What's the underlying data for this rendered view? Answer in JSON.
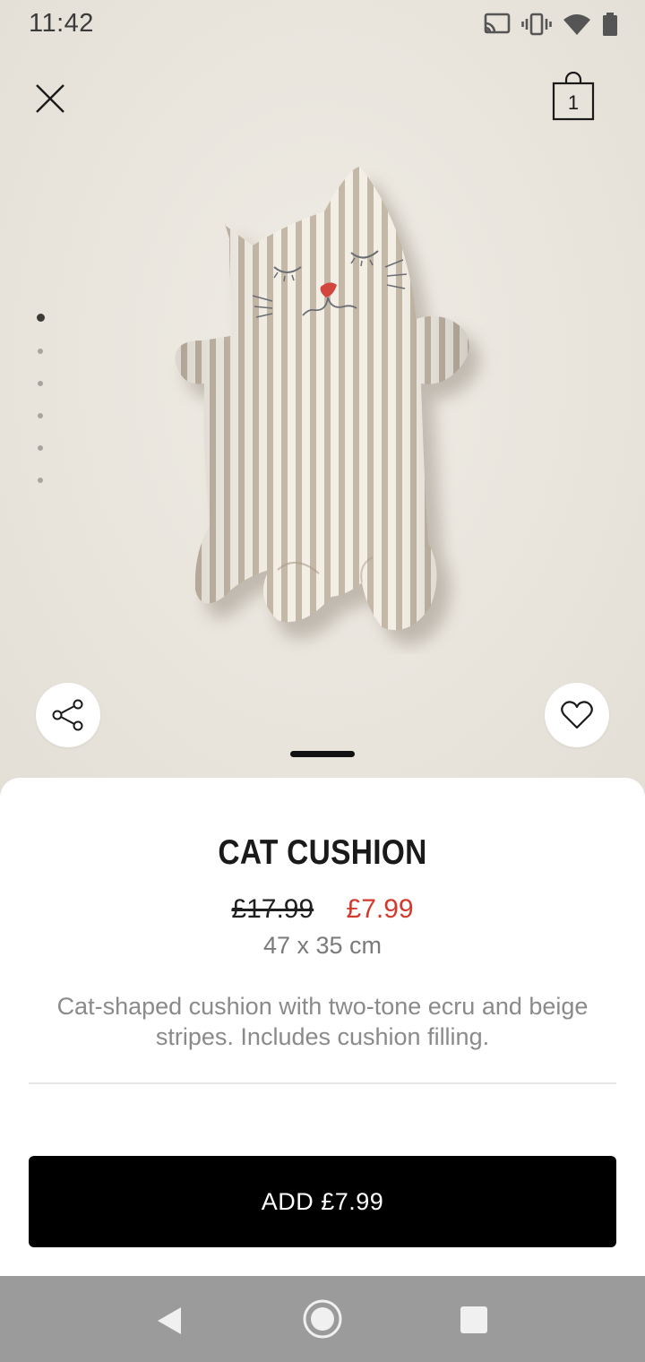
{
  "status_bar": {
    "time": "11:42",
    "icons": [
      "cast-icon",
      "vibrate-icon",
      "wifi-icon",
      "battery-icon"
    ]
  },
  "header": {
    "close_icon": "close-icon",
    "bag_icon": "shopping-bag-icon",
    "bag_count": "1"
  },
  "gallery": {
    "image_count": 6,
    "active_index": 0,
    "image_subject": "striped cat-shaped cushion"
  },
  "actions": {
    "share_icon": "share-icon",
    "favorite_icon": "heart-icon"
  },
  "product": {
    "name": "CAT CUSHION",
    "old_price": "£17.99",
    "new_price": "£7.99",
    "dimensions": "47 x 35 cm",
    "description": "Cat-shaped cushion with two-tone ecru and beige stripes. Includes cushion filling."
  },
  "cta": {
    "label": "ADD £7.99"
  },
  "colors": {
    "sale_price": "#d23a2d",
    "cta_background": "#000000",
    "cta_text": "#ffffff",
    "nav_bar": "#9b9b9b"
  },
  "nav_bar": {
    "buttons": [
      "back-icon",
      "home-icon",
      "recents-icon"
    ]
  }
}
